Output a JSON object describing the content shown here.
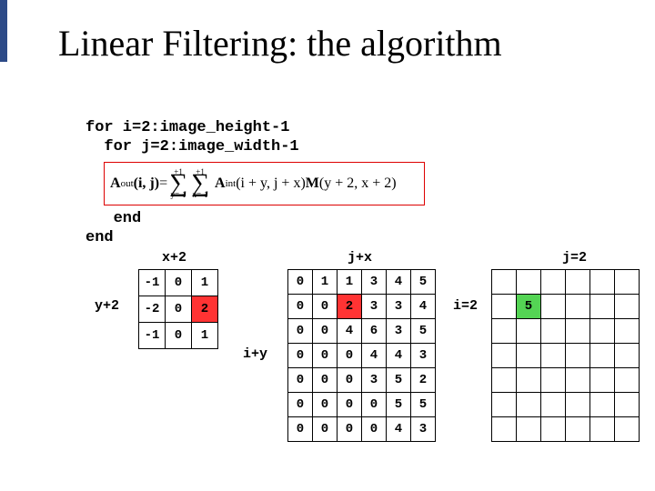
{
  "title": "Linear Filtering: the algorithm",
  "code_top_line1": "for i=2:image_height-1",
  "code_top_line2": "  for j=2:image_width-1",
  "code_bot_line1": "   end",
  "code_bot_line2": "end",
  "formula": {
    "lhs_sym": "A",
    "lhs_sub": "out",
    "lhs_args": "(i, j)",
    "eq": " = ",
    "sig1_top": "+1",
    "sig1_bot": "y=-1",
    "sig2_top": "+1",
    "sig2_bot": "x=-1",
    "rhs_A": "A",
    "rhs_Asub": "int",
    "rhs_Aargs": "(i + y, j + x)",
    "rhs_M": "M",
    "rhs_Margs": "(y + 2, x + 2)"
  },
  "labels": {
    "kernel_top": "x+2",
    "kernel_left": "y+2",
    "image_top": "j+x",
    "image_left": "i+y",
    "output_top": "j=2",
    "output_left": "i=2"
  },
  "kernel": [
    [
      "-1",
      "0",
      "1"
    ],
    [
      "-2",
      "0",
      "2"
    ],
    [
      "-1",
      "0",
      "1"
    ]
  ],
  "kernel_highlight": {
    "r": 1,
    "c": 2
  },
  "image": [
    [
      "0",
      "1",
      "1",
      "3",
      "4",
      "5"
    ],
    [
      "0",
      "0",
      "2",
      "3",
      "3",
      "4"
    ],
    [
      "0",
      "0",
      "4",
      "6",
      "3",
      "5"
    ],
    [
      "0",
      "0",
      "0",
      "4",
      "4",
      "3"
    ],
    [
      "0",
      "0",
      "0",
      "3",
      "5",
      "2"
    ],
    [
      "0",
      "0",
      "0",
      "0",
      "5",
      "5"
    ],
    [
      "0",
      "0",
      "0",
      "0",
      "4",
      "3"
    ]
  ],
  "image_highlight": {
    "r": 1,
    "c": 2
  },
  "output_size": {
    "rows": 7,
    "cols": 6
  },
  "output_value": "5",
  "output_highlight": {
    "r": 1,
    "c": 1
  }
}
